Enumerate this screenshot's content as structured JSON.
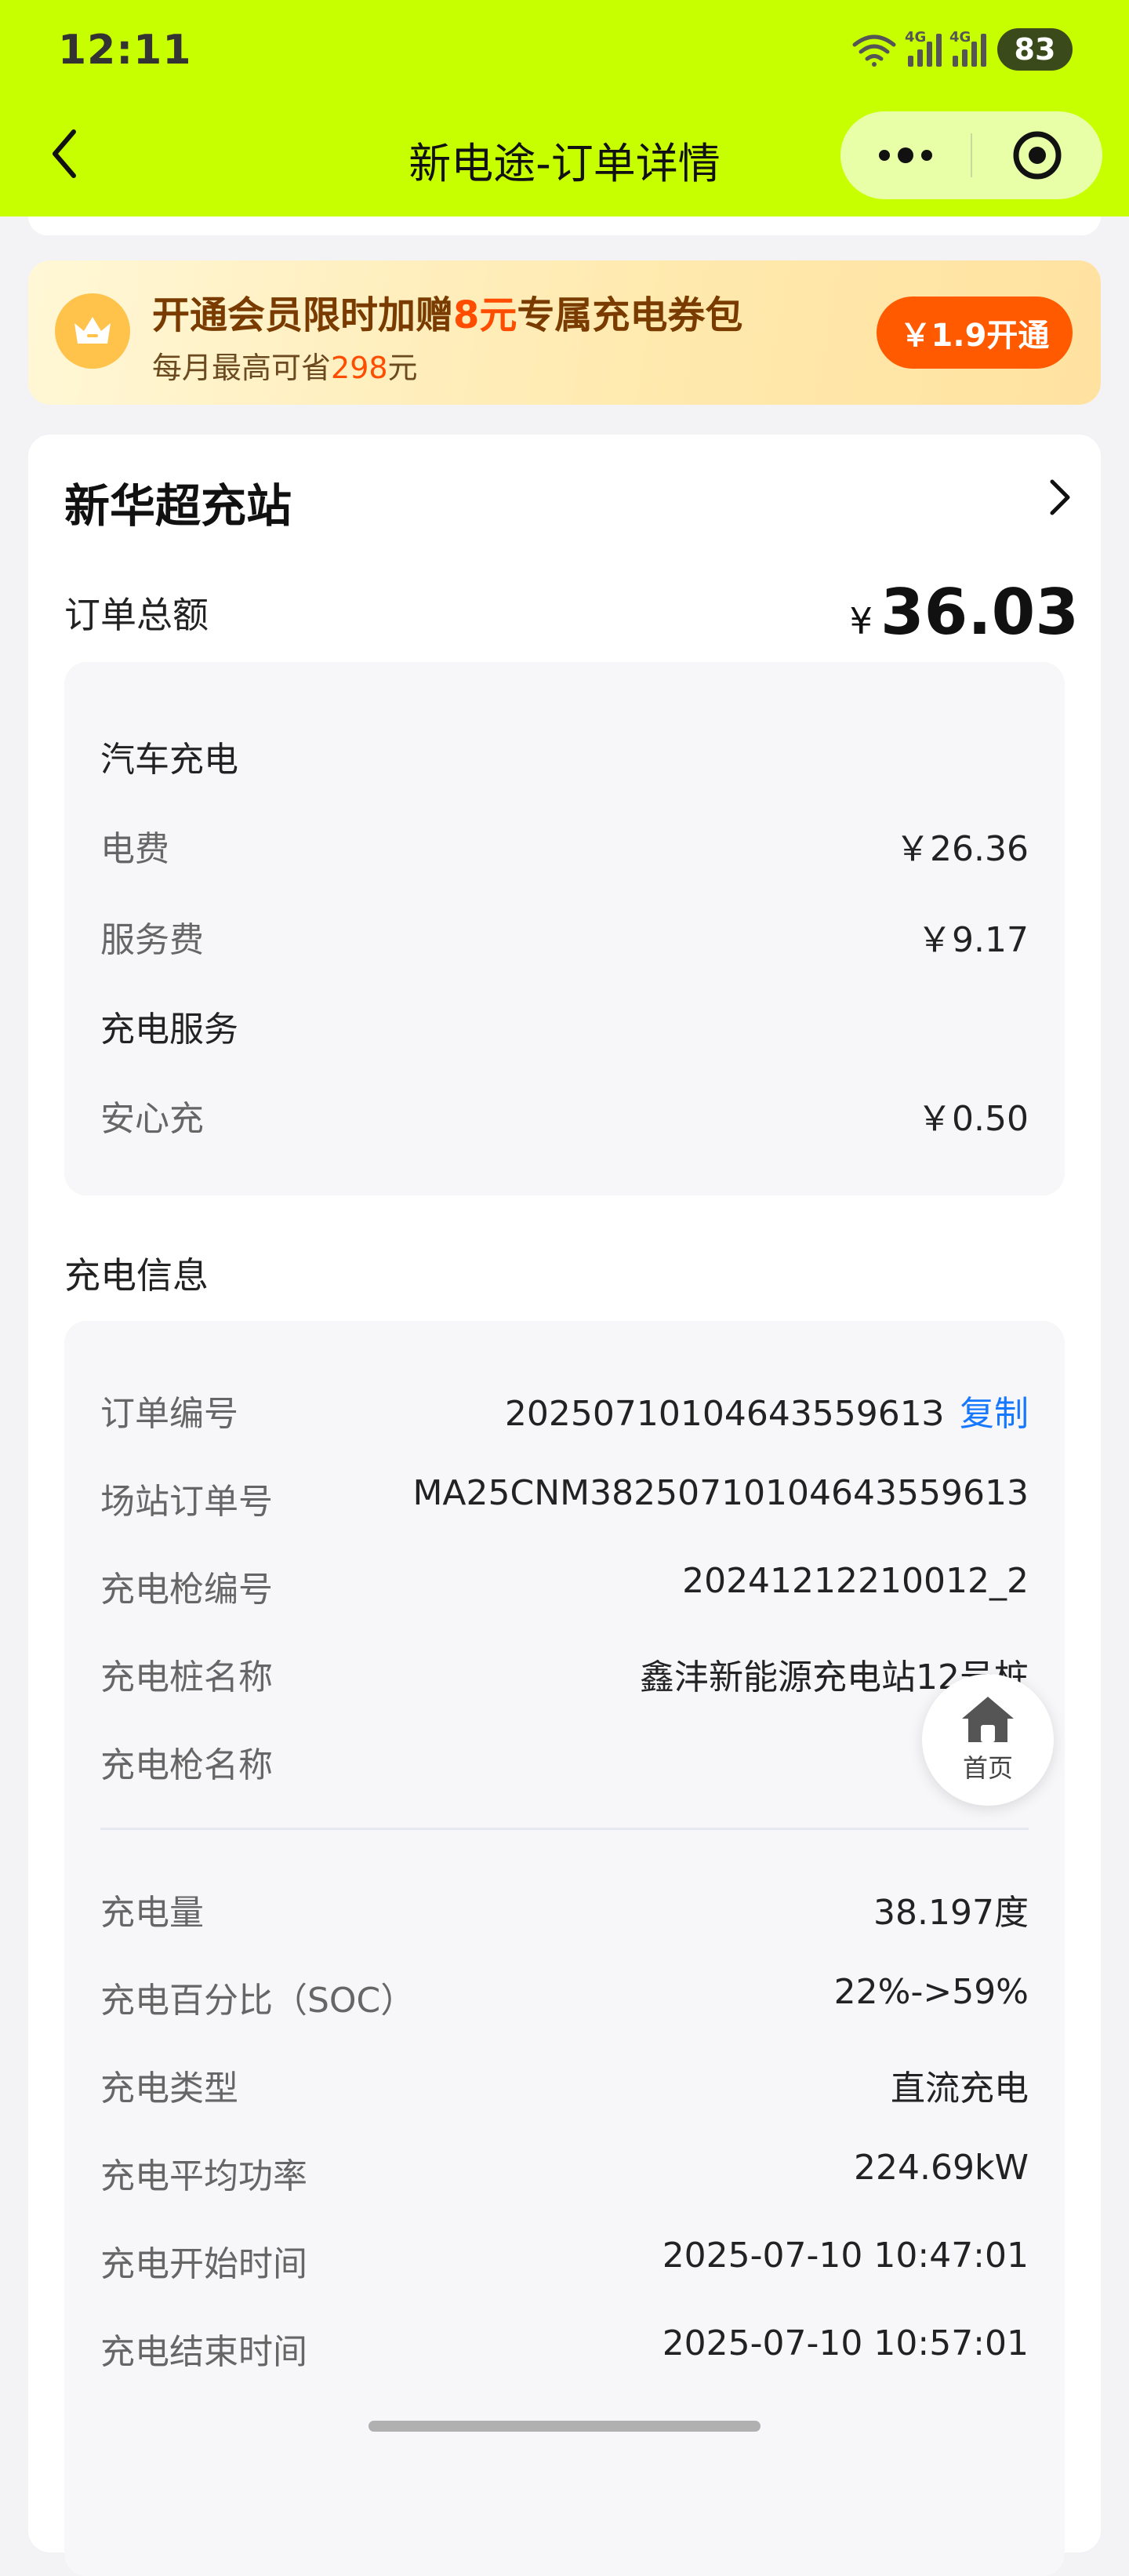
{
  "status_bar": {
    "time": "12:11",
    "network_1": "4G",
    "network_2": "4G",
    "battery": "83"
  },
  "nav": {
    "title": "新电途-订单详情"
  },
  "promo": {
    "title_pre": "开通会员限时加赠",
    "title_hl": "8元",
    "title_post": "专属充电券包",
    "sub_pre": "每月最高可省",
    "sub_hl": "298",
    "sub_post": "元",
    "button": "￥1.9开通"
  },
  "station": {
    "name": "新华超充站"
  },
  "order_total": {
    "label": "订单总额",
    "currency": "¥",
    "amount": "36.03"
  },
  "fees": {
    "charging_header": "汽车充电",
    "items": [
      {
        "label": "电费",
        "value": "￥26.36"
      },
      {
        "label": "服务费",
        "value": "￥9.17"
      }
    ],
    "service_header": "充电服务",
    "service_items": [
      {
        "label": "安心充",
        "value": "￥0.50"
      }
    ]
  },
  "charging_info": {
    "title": "充电信息",
    "order_no_label": "订单编号",
    "order_no": "2025071010464355961З",
    "copy_label": "复制",
    "rows_top": [
      {
        "label": "场站订单号",
        "value": "MA25CNM38250710104643559613"
      },
      {
        "label": "充电枪编号",
        "value": "20241212210012_2"
      },
      {
        "label": "充电桩名称",
        "value": "鑫沣新能源充电站12号桩"
      },
      {
        "label": "充电枪名称",
        "value": ""
      }
    ],
    "rows_bottom": [
      {
        "label": "充电量",
        "value": "38.197度"
      },
      {
        "label": "充电百分比（SOC）",
        "value": "22%->59%"
      },
      {
        "label": "充电类型",
        "value": "直流充电"
      },
      {
        "label": "充电平均功率",
        "value": "224.69kW"
      },
      {
        "label": "充电开始时间",
        "value": "2025-07-10 10:47:01"
      },
      {
        "label": "充电结束时间",
        "value": "2025-07-10 10:57:01"
      }
    ]
  },
  "home_button": {
    "label": "首页"
  }
}
